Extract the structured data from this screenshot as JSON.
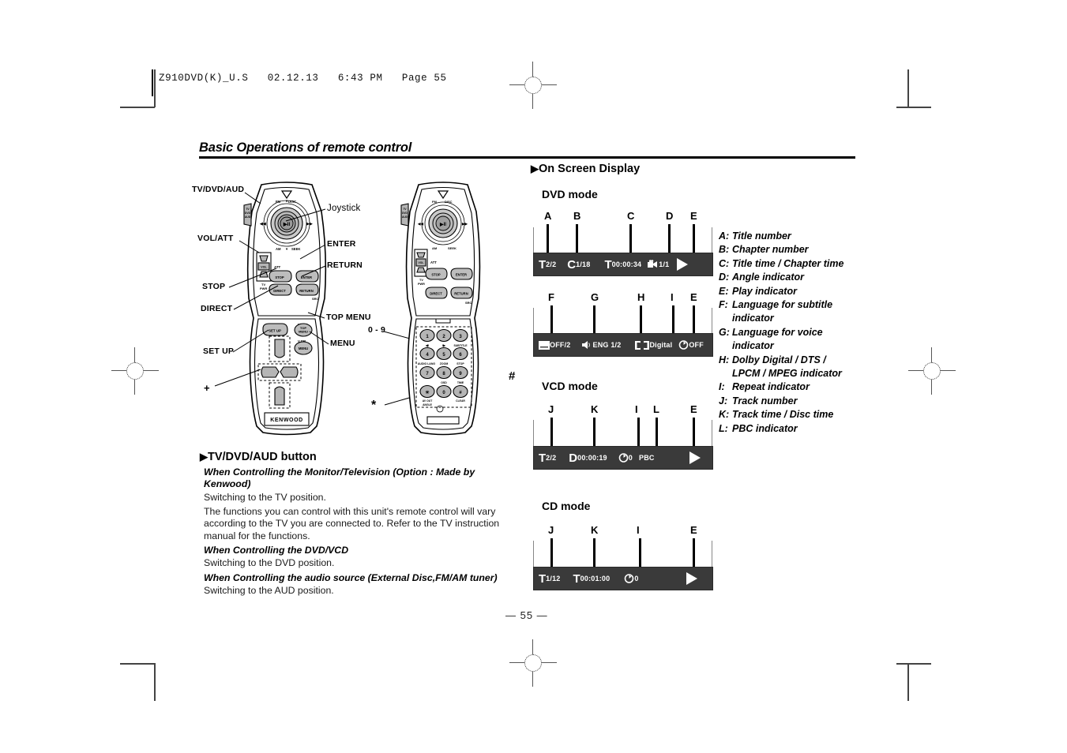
{
  "print": {
    "slug": "Z910DVD(K)_U.S   02.12.13   6:43 PM   Page 55"
  },
  "section": {
    "title": "Basic Operations of remote control"
  },
  "page": {
    "number": "— 55 —"
  },
  "remote_left": {
    "brand": "KENWOOD",
    "callouts_left": [
      {
        "label": "TV/DVD/AUD"
      },
      {
        "label": "VOL/ATT"
      },
      {
        "label": "STOP"
      },
      {
        "label": "DIRECT"
      },
      {
        "label": "SET UP"
      },
      {
        "label": "+"
      }
    ],
    "callouts_right": [
      {
        "label": "Joystick"
      },
      {
        "label": "ENTER"
      },
      {
        "label": "RETURN"
      },
      {
        "label": "TOP MENU"
      },
      {
        "label": "MENU"
      }
    ],
    "face_labels": {
      "top_band": "FM",
      "top_band2": "DISC",
      "bottom_band": "AM",
      "seek_left": "⦀",
      "seek_right": "⦀",
      "joystick": "▶II",
      "side_switch": "TV\nDVD\nAUD",
      "vol": "VOL",
      "att": "ATT",
      "tv_pwr": "TV\nPWR",
      "src": "SRC",
      "open": "OPEN",
      "mode": "MODE",
      "vsel": "V.SEL",
      "setup": "SET UP",
      "topmenu": "TOP\nMENU",
      "menu": "MENU",
      "stop": "STOP",
      "enter": "ENTER",
      "direct": "DIRECT",
      "return": "RETURN"
    }
  },
  "remote_right": {
    "callouts": [
      {
        "label": "0 - 9"
      },
      {
        "label": "#"
      },
      {
        "label": "*"
      }
    ],
    "keypad": [
      {
        "key": "1",
        "sub": "◂I"
      },
      {
        "key": "2",
        "sub": "I▸"
      },
      {
        "key": "3",
        "sub": "SUBTITLE"
      },
      {
        "key": "4",
        "sub": "AUDIO LANG"
      },
      {
        "key": "5",
        "sub": "ZOOM"
      },
      {
        "key": "6",
        "sub": "STOP"
      },
      {
        "key": "7",
        "sub": ""
      },
      {
        "key": "8",
        "sub": "OSD"
      },
      {
        "key": "9",
        "sub": "TIME"
      },
      {
        "key": "✱",
        "sub": "AV OUT\nANGLE"
      },
      {
        "key": "0",
        "sub": ""
      },
      {
        "key": "#",
        "sub": "CLEAR"
      }
    ]
  },
  "tv_dvd_aud": {
    "heading": "TV/DVD/AUD button",
    "blocks": [
      {
        "type": "bold",
        "text": "When Controlling the Monitor/Television (Option : Made by Kenwood)"
      },
      {
        "type": "plain",
        "text": "Switching to the TV position."
      },
      {
        "type": "plain",
        "text": "The functions you can control with this unit's remote control will vary according to the TV you are connected to. Refer to the TV instruction manual for the functions."
      },
      {
        "type": "bold",
        "text": "When Controlling the DVD/VCD"
      },
      {
        "type": "plain",
        "text": "Switching to the DVD position."
      },
      {
        "type": "bold",
        "text": "When Controlling the audio source (External Disc,FM/AM tuner)"
      },
      {
        "type": "plain",
        "text": "Switching to the AUD position."
      }
    ]
  },
  "osd": {
    "heading": "On Screen Display",
    "dvd": {
      "mode_label": "DVD mode",
      "row1": {
        "callouts": [
          "A",
          "B",
          "C",
          "D",
          "E"
        ],
        "items": [
          {
            "icon": "title-icon",
            "glyph": "T",
            "value": "2/2"
          },
          {
            "icon": "chapter-icon",
            "glyph": "C",
            "value": "1/18"
          },
          {
            "icon": "time-icon",
            "glyph": "T",
            "value": "00:00:34"
          },
          {
            "icon": "angle-camera-icon",
            "glyph": "",
            "value": "1/1"
          },
          {
            "icon": "play-icon",
            "glyph": "",
            "value": ""
          }
        ]
      },
      "row2": {
        "callouts": [
          "F",
          "G",
          "H",
          "I",
          "E"
        ],
        "items": [
          {
            "icon": "subtitle-icon",
            "glyph": "",
            "value": "OFF/2"
          },
          {
            "icon": "speaker-icon",
            "glyph": "",
            "value": "ENG 1/2"
          },
          {
            "icon": "dolby-icon",
            "glyph": "",
            "value": "Digital"
          },
          {
            "icon": "repeat-icon",
            "glyph": "",
            "value": "OFF"
          },
          {
            "icon": "play-icon",
            "glyph": "",
            "value": ""
          }
        ]
      }
    },
    "vcd": {
      "mode_label": "VCD mode",
      "callouts": [
        "J",
        "K",
        "I",
        "L",
        "E"
      ],
      "items": [
        {
          "icon": "track-icon",
          "glyph": "T",
          "value": "2/2"
        },
        {
          "icon": "disc-time-icon",
          "glyph": "D",
          "value": "00:00:19"
        },
        {
          "icon": "repeat-icon",
          "glyph": "",
          "value": "0"
        },
        {
          "icon": "pbc-icon",
          "glyph": "",
          "value": "PBC"
        },
        {
          "icon": "play-icon",
          "glyph": "",
          "value": ""
        }
      ]
    },
    "cd": {
      "mode_label": "CD mode",
      "callouts": [
        "J",
        "K",
        "I",
        "E"
      ],
      "items": [
        {
          "icon": "track-icon",
          "glyph": "T",
          "value": "1/12"
        },
        {
          "icon": "time-icon",
          "glyph": "T",
          "value": "00:01:00"
        },
        {
          "icon": "repeat-icon",
          "glyph": "",
          "value": "0"
        },
        {
          "icon": "play-icon",
          "glyph": "",
          "value": ""
        }
      ]
    },
    "legend": [
      {
        "key": "A:",
        "text": "Title number"
      },
      {
        "key": "B:",
        "text": "Chapter number"
      },
      {
        "key": "C:",
        "text": "Title time / Chapter time"
      },
      {
        "key": "D:",
        "text": "Angle indicator"
      },
      {
        "key": "E:",
        "text": "Play indicator"
      },
      {
        "key": "F:",
        "text": "Language for subtitle",
        "cont": "indicator"
      },
      {
        "key": "G:",
        "text": "Language for voice",
        "cont": "indicator"
      },
      {
        "key": "H:",
        "text": "Dolby Digital / DTS /",
        "cont": "LPCM / MPEG indicator"
      },
      {
        "key": "I:",
        "text": "Repeat indicator"
      },
      {
        "key": "J:",
        "text": "Track number"
      },
      {
        "key": "K:",
        "text": "Track time / Disc time"
      },
      {
        "key": "L:",
        "text": "PBC indicator"
      }
    ]
  }
}
